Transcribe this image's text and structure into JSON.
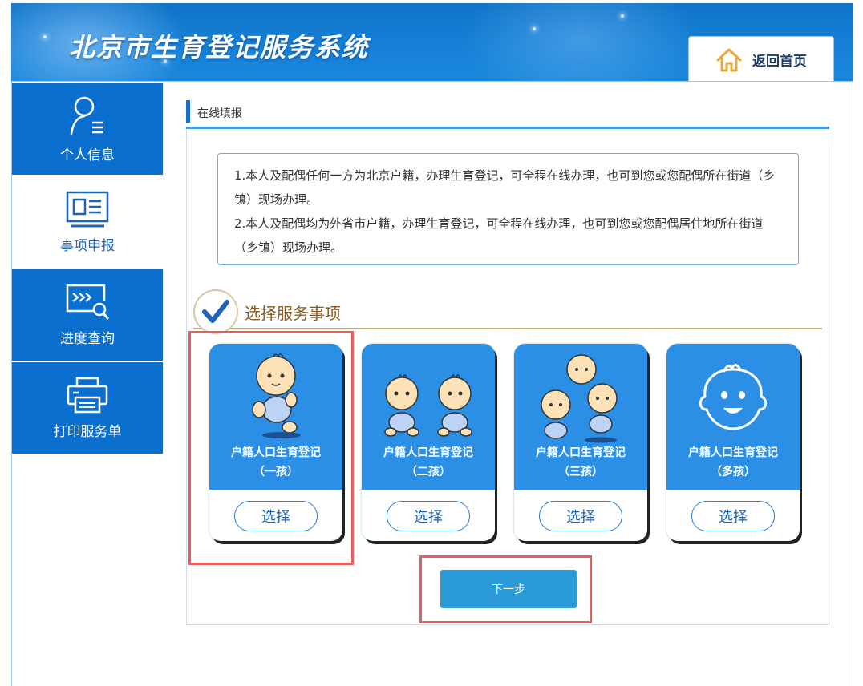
{
  "header": {
    "title": "北京市生育登记服务系统",
    "home_label": "返回首页"
  },
  "sidebar": {
    "items": [
      {
        "label": "个人信息",
        "icon": "person-list-icon",
        "active": false
      },
      {
        "label": "事项申报",
        "icon": "id-card-icon",
        "active": true
      },
      {
        "label": "进度查询",
        "icon": "search-document-icon",
        "active": false
      },
      {
        "label": "打印服务单",
        "icon": "printer-icon",
        "active": false
      }
    ]
  },
  "breadcrumb": {
    "label": "在线填报"
  },
  "notice": {
    "line1": "1.本人及配偶任何一方为北京户籍，办理生育登记，可全程在线办理，也可到您或您配偶所在街道（乡镇）现场办理。",
    "line2": "2.本人及配偶均为外省市户籍，办理生育登记，可全程在线办理，也可到您或您配偶居住地所在街道（乡镇）现场办理。"
  },
  "section": {
    "title": "选择服务事项"
  },
  "cards": [
    {
      "title": "户籍人口生育登记",
      "subtitle": "（一孩）",
      "button": "选择"
    },
    {
      "title": "户籍人口生育登记",
      "subtitle": "（二孩）",
      "button": "选择"
    },
    {
      "title": "户籍人口生育登记",
      "subtitle": "（三孩）",
      "button": "选择"
    },
    {
      "title": "户籍人口生育登记",
      "subtitle": "（多孩）",
      "button": "选择"
    }
  ],
  "next_button": "下一步",
  "colors": {
    "header_blue": "#0f74c9",
    "sidebar_blue": "#0b6fd0",
    "card_blue": "#2b8fe6",
    "highlight_red": "#e95c5c",
    "section_gold": "#8a5a1f"
  }
}
